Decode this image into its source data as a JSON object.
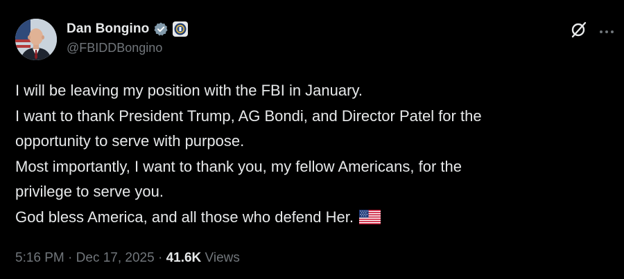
{
  "author": {
    "display_name": "Dan Bongino",
    "handle": "@FBIDDBongino",
    "verified_icon": "verified-badge-icon",
    "affiliate_icon": "fbi-seal-icon"
  },
  "header_actions": {
    "grok_icon": "grok-icon",
    "more_icon": "more-options-icon"
  },
  "tweet": {
    "lines": [
      "I will be leaving my position with the FBI in January.",
      "I want to thank President Trump, AG Bondi, and Director Patel for the",
      "opportunity to serve with purpose.",
      "Most importantly, I want to thank you, my fellow Americans, for the",
      "privilege to serve you.",
      "God bless America, and all those who defend Her."
    ],
    "emoji": "us-flag-emoji"
  },
  "meta": {
    "time": "5:16 PM",
    "separator_1": " · ",
    "date": "Dec 17, 2025",
    "separator_2": " · ",
    "views_count": "41.6K",
    "views_label": " Views"
  },
  "colors": {
    "background": "#000000",
    "primary_text": "#e7e9ea",
    "secondary_text": "#71767b",
    "verified": "#829aab"
  }
}
